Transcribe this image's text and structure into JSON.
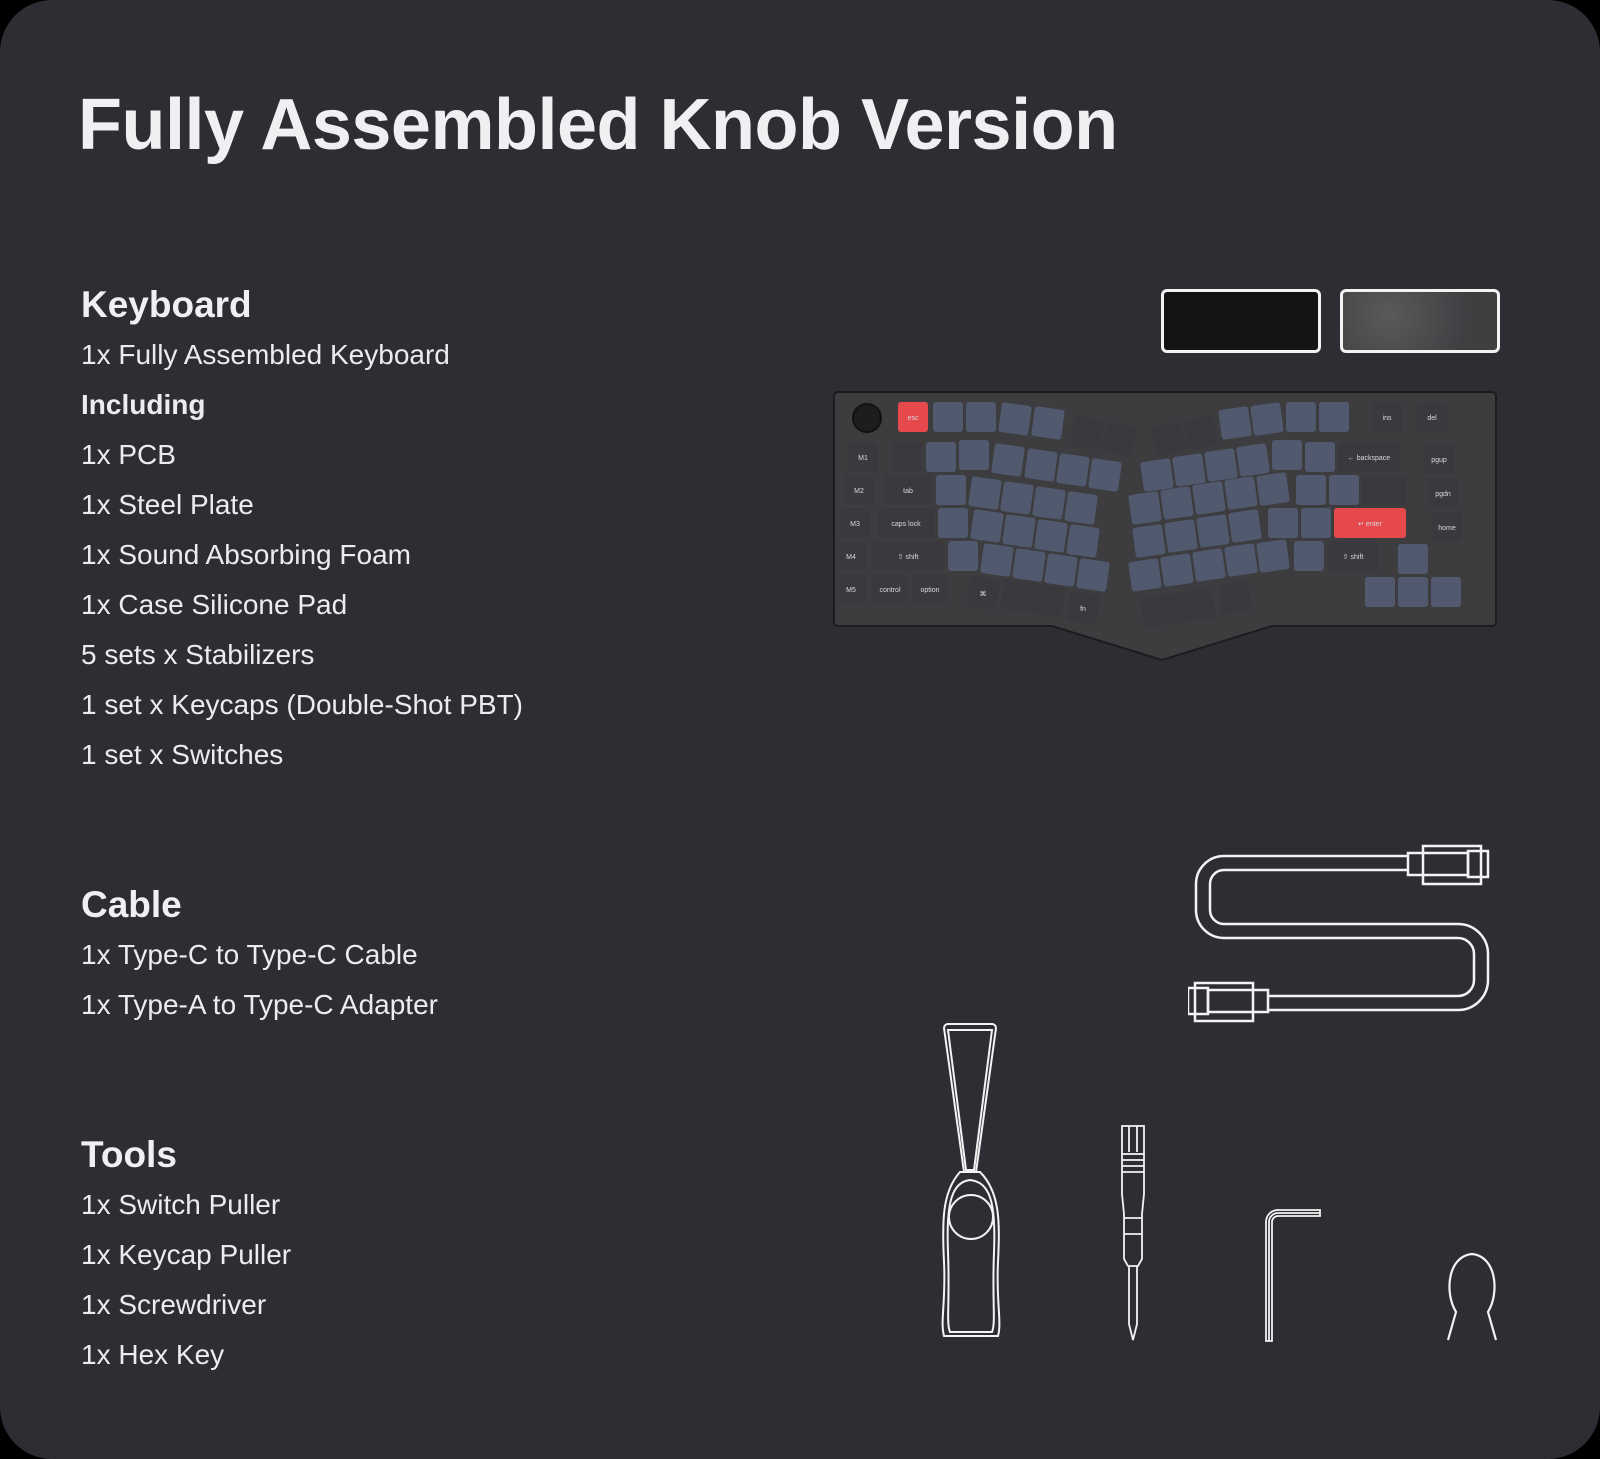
{
  "title": "Fully Assembled Knob Version",
  "sections": {
    "keyboard": {
      "heading": "Keyboard",
      "items": [
        "1x Fully Assembled Keyboard",
        "Including",
        "1x PCB",
        "1x Steel Plate",
        "1x Sound Absorbing Foam",
        "1x Case Silicone Pad",
        "5 sets x Stabilizers",
        "1 set x Keycaps (Double-Shot PBT)",
        "1 set x Switches"
      ]
    },
    "cable": {
      "heading": "Cable",
      "items": [
        "1x Type-C to Type-C Cable",
        "1x Type-A to Type-C Adapter"
      ]
    },
    "tools": {
      "heading": "Tools",
      "items": [
        "1x Switch Puller",
        "1x Keycap Puller",
        "1x Screwdriver",
        "1x Hex Key"
      ]
    }
  },
  "keyboard_image": {
    "keys": {
      "esc": "esc",
      "m1": "M1",
      "m2": "M2",
      "m3": "M3",
      "m4": "M4",
      "m5": "M5",
      "tab": "tab",
      "caps": "caps lock",
      "lshift": "⇧ shift",
      "control": "control",
      "option": "option",
      "backspace": "← backspace",
      "enter": "↵ enter",
      "rshift": "⇧ shift",
      "ins": "ins",
      "del": "del",
      "pgup": "pgup",
      "pgdn": "pgdn",
      "home": "home",
      "fn": "fn",
      "cmd": "⌘"
    },
    "colors": {
      "accent": "#e5494b",
      "alpha": "#51596e",
      "mod": "#3a3a3e",
      "case": "#3d3d40"
    }
  },
  "colors": {
    "background": "#2e2d33",
    "text": "#f0f0f2",
    "line_art": "#f3f3f3"
  }
}
